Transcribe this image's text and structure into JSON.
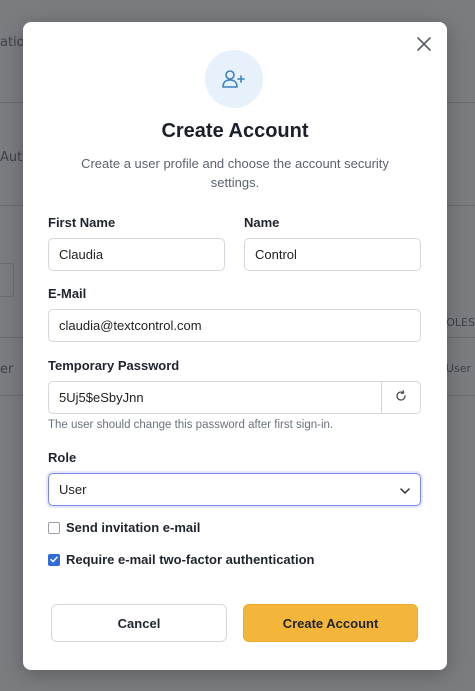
{
  "background": {
    "fragments": [
      "atio",
      "Auth",
      "ROLES",
      "er",
      "User"
    ]
  },
  "modal": {
    "title": "Create Account",
    "subtitle": "Create a user profile and choose the account security settings.",
    "icon": "user-plus-icon",
    "close_icon": "close-icon"
  },
  "form": {
    "first_name": {
      "label": "First Name",
      "value": "Claudia"
    },
    "name": {
      "label": "Name",
      "value": "Control"
    },
    "email": {
      "label": "E-Mail",
      "value": "claudia@textcontrol.com"
    },
    "password": {
      "label": "Temporary Password",
      "value": "5Uj5$eSbyJnn",
      "hint": "The user should change this password after first sign-in.",
      "regenerate_icon": "refresh-icon"
    },
    "role": {
      "label": "Role",
      "value": "User"
    },
    "send_invitation": {
      "label": "Send invitation e-mail",
      "checked": false
    },
    "require_2fa": {
      "label": "Require e-mail two-factor authentication",
      "checked": true
    }
  },
  "actions": {
    "cancel_label": "Cancel",
    "create_label": "Create Account"
  },
  "colors": {
    "accent": "#f3b63a",
    "checkbox_checked": "#2f6bd9",
    "icon_bg": "#e6f1fb",
    "icon_fg": "#3b82c4"
  }
}
